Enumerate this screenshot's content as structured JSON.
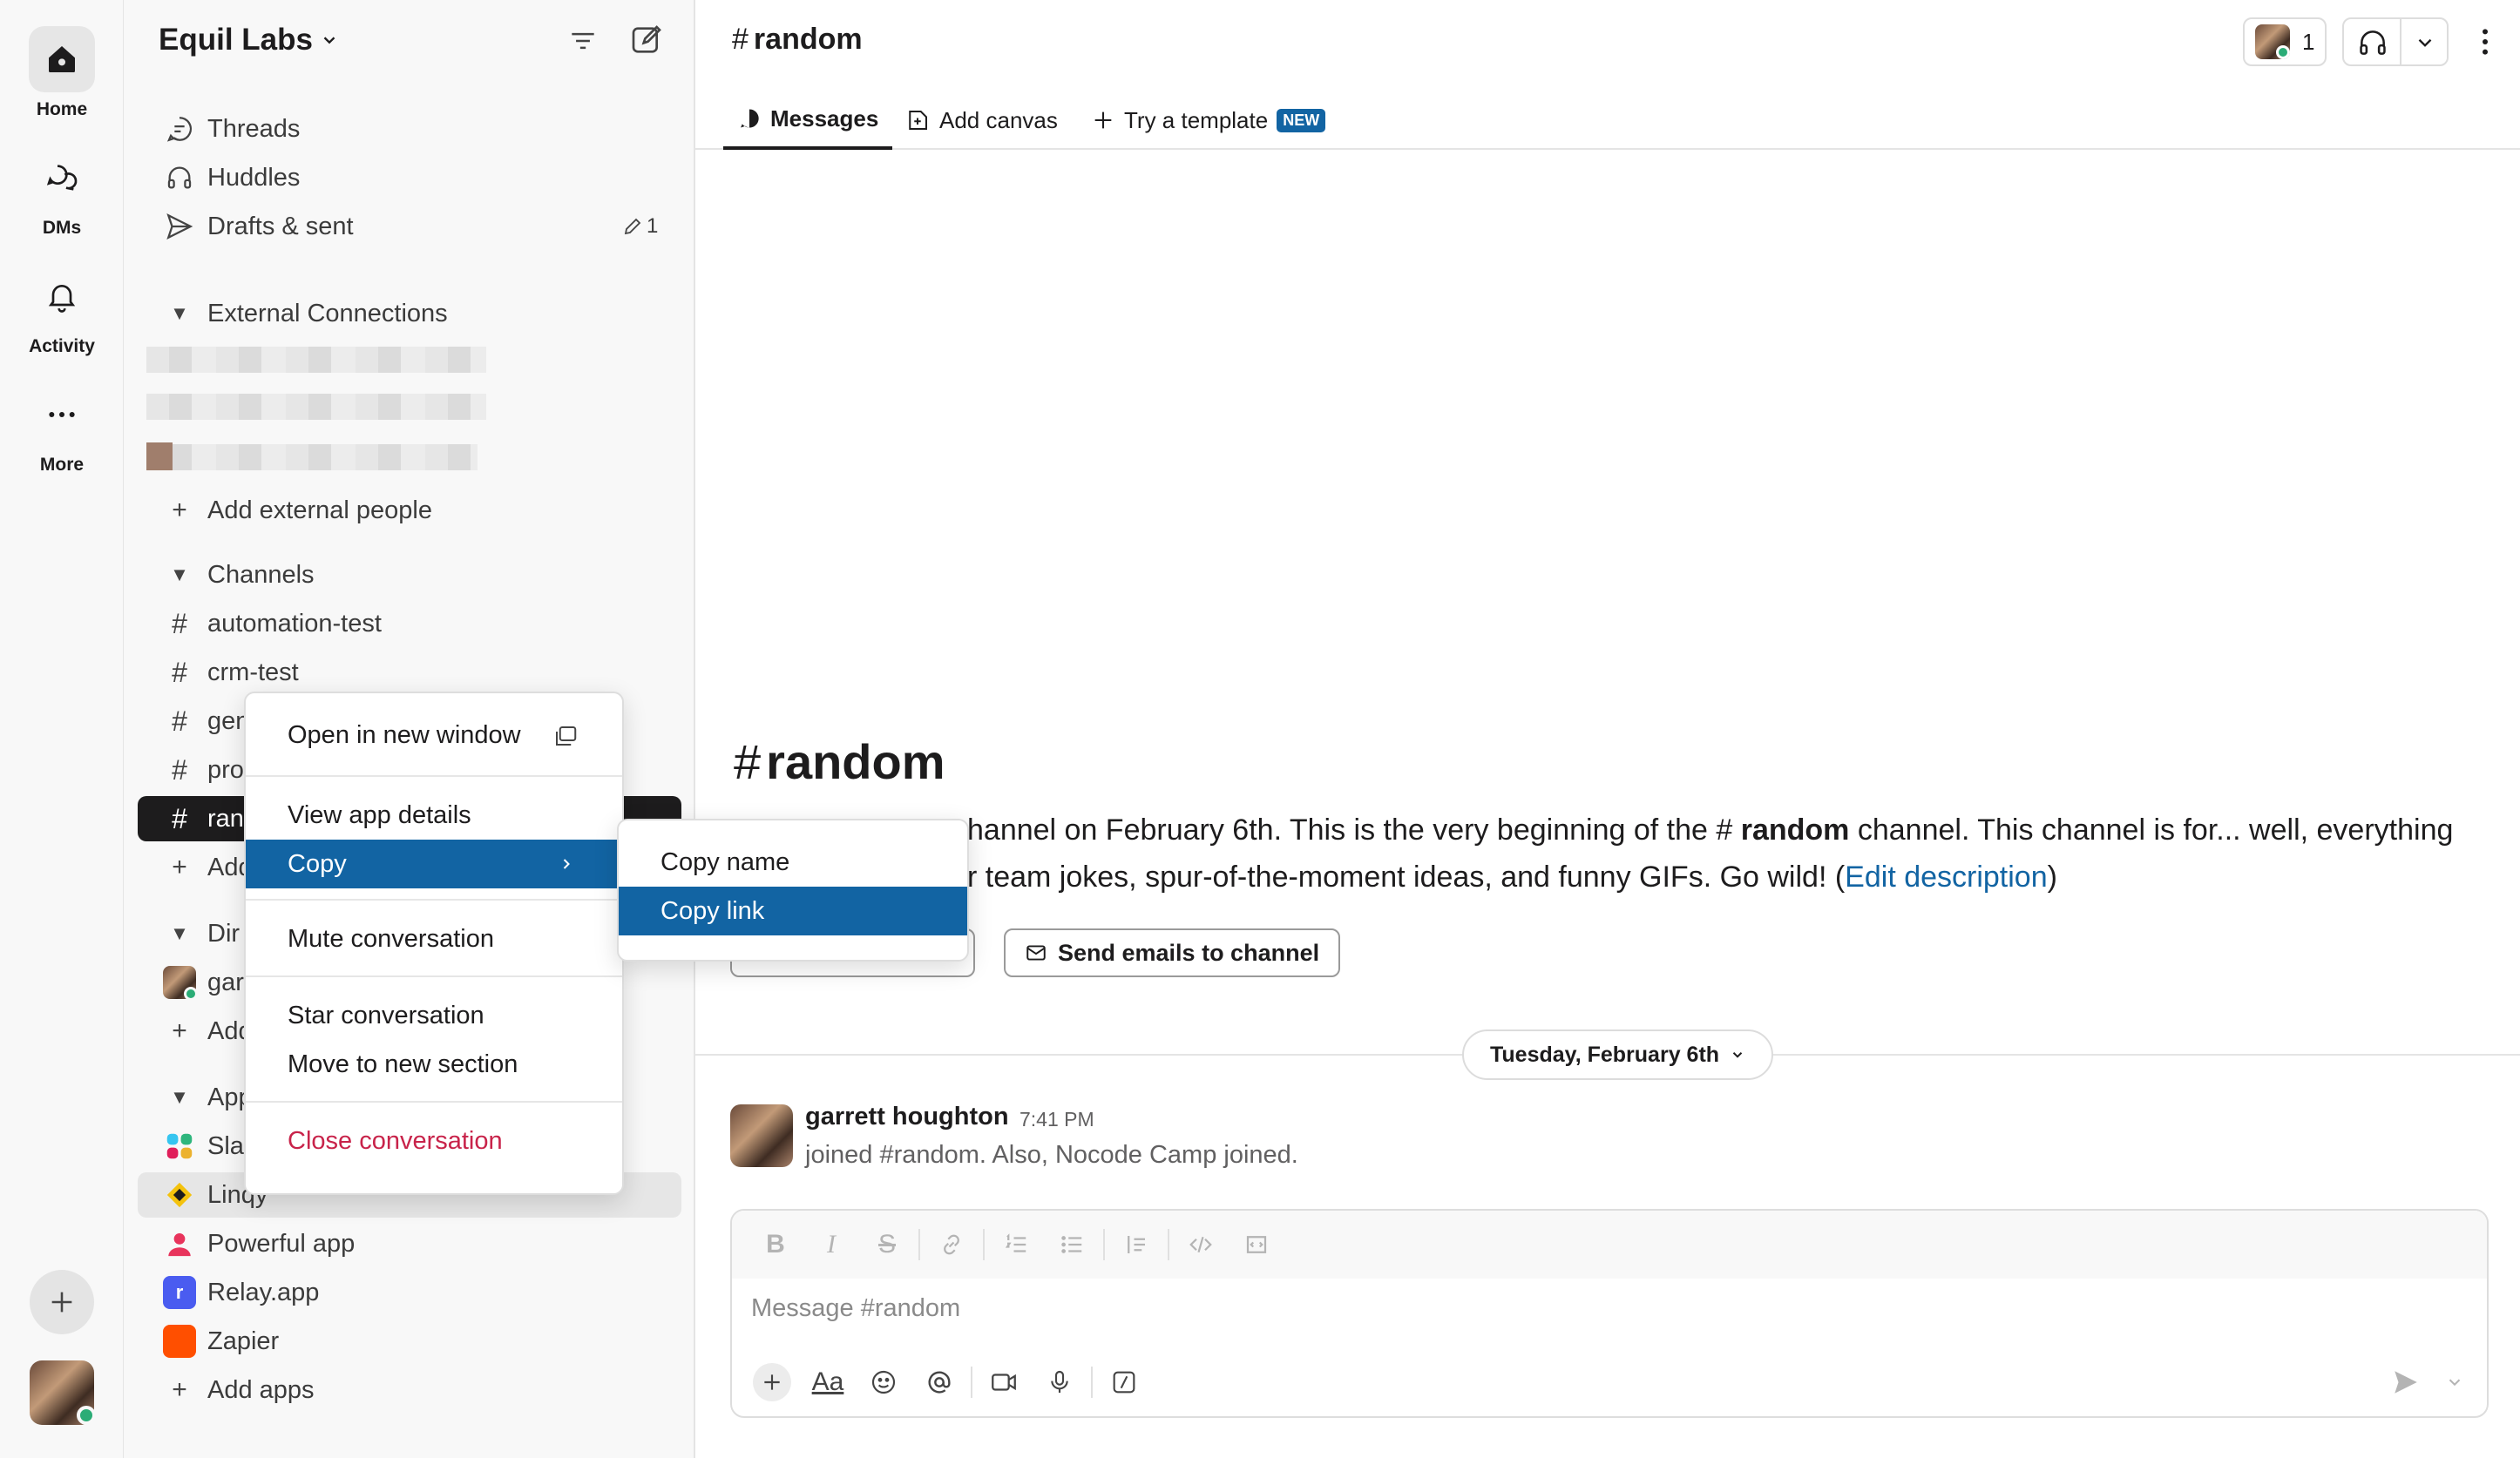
{
  "rail": {
    "items": [
      {
        "label": "Home"
      },
      {
        "label": "DMs"
      },
      {
        "label": "Activity"
      },
      {
        "label": "More"
      }
    ]
  },
  "workspace": {
    "name": "Equil Labs"
  },
  "sidebar": {
    "top": [
      {
        "label": "Threads"
      },
      {
        "label": "Huddles"
      },
      {
        "label": "Drafts & sent",
        "count": "1"
      }
    ],
    "external": {
      "header": "External Connections",
      "add": "Add external people"
    },
    "channels": {
      "header": "Channels",
      "items": [
        "automation-test",
        "crm-test",
        "gen",
        "pro",
        "ran"
      ],
      "add": "Add"
    },
    "dms": {
      "header": "Dir",
      "items": [
        "gar"
      ],
      "add": "Add"
    },
    "apps": {
      "header": "App",
      "items": [
        "Slac",
        "Linqy",
        "Powerful app",
        "Relay.app",
        "Zapier"
      ],
      "add": "Add apps"
    }
  },
  "channel": {
    "name": "random",
    "member_count": "1",
    "tabs": [
      {
        "label": "Messages"
      },
      {
        "label": "Add canvas"
      },
      {
        "label": "Try a template",
        "badge": "NEW"
      }
    ],
    "intro": {
      "title": "random",
      "line1_pre": "hannel on February 6th. This is the very beginning of the ",
      "line1_channel": "random",
      "line1_post": " channel. This channel is for... well, everything",
      "line2_pre": "r team jokes, spur-of-the-moment ideas, and funny GIFs. Go wild! (",
      "line2_link": "Edit description",
      "line2_post": ")",
      "btn_add_coworkers": "Add coworkers",
      "btn_send_emails": "Send emails to channel"
    },
    "date_divider": "Tuesday, February 6th",
    "message": {
      "author": "garrett houghton",
      "time": "7:41 PM",
      "body": "joined #random. Also, Nocode Camp joined."
    },
    "composer": {
      "placeholder": "Message #random"
    }
  },
  "context_menu": {
    "items": [
      {
        "label": "Open in new window"
      },
      {
        "label": "View app details"
      },
      {
        "label": "Copy"
      },
      {
        "label": "Mute conversation"
      },
      {
        "label": "Star conversation"
      },
      {
        "label": "Move to new section"
      },
      {
        "label": "Close conversation"
      }
    ],
    "submenu": [
      {
        "label": "Copy name"
      },
      {
        "label": "Copy link"
      }
    ]
  },
  "colors": {
    "accent": "#1264a3",
    "danger": "#c8234a",
    "presence": "#2bac76",
    "selected_row": "#1d1c1d"
  }
}
